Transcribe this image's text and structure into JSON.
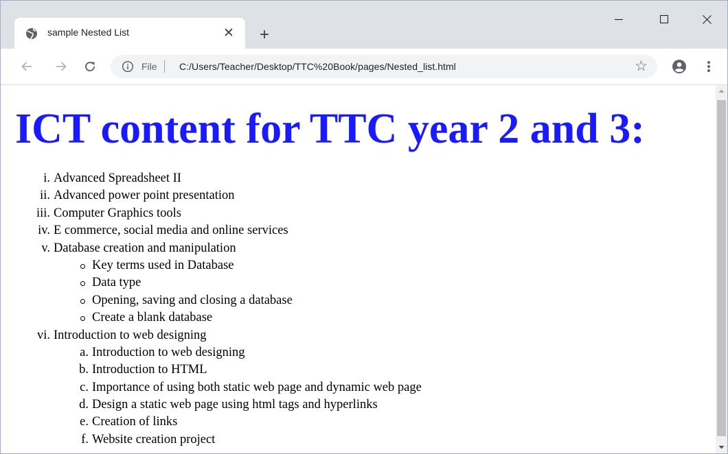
{
  "browser": {
    "tab_title": "sample Nested List",
    "new_tab_label": "+",
    "address_scheme_label": "File",
    "url": "C:/Users/Teacher/Desktop/TTC%20Book/pages/Nested_list.html"
  },
  "page": {
    "heading": "ICT content for TTC year 2 and 3:",
    "heading_color": "#1a1aff",
    "topics": [
      {
        "marker": "i.",
        "text": "Advanced Spreadsheet II"
      },
      {
        "marker": "ii.",
        "text": "Advanced power point presentation"
      },
      {
        "marker": "iii.",
        "text": "Computer Graphics tools"
      },
      {
        "marker": "iv.",
        "text": "E commerce, social media and online services"
      },
      {
        "marker": "v.",
        "text": "Database creation and manipulation",
        "subitems": [
          {
            "marker": "circle",
            "text": "Key terms used in Database"
          },
          {
            "marker": "circle",
            "text": "Data type"
          },
          {
            "marker": "circle",
            "text": "Opening, saving and closing a database"
          },
          {
            "marker": "circle",
            "text": "Create a blank database"
          }
        ]
      },
      {
        "marker": "vi.",
        "text": "Introduction to web designing",
        "subitems": [
          {
            "marker": "a.",
            "text": "Introduction to web designing"
          },
          {
            "marker": "b.",
            "text": "Introduction to HTML"
          },
          {
            "marker": "c.",
            "text": "Importance of using both static web page and dynamic web page"
          },
          {
            "marker": "d.",
            "text": "Design a static web page using html tags and hyperlinks"
          },
          {
            "marker": "e.",
            "text": "Creation of links"
          },
          {
            "marker": "f.",
            "text": "Website creation project"
          }
        ]
      }
    ]
  },
  "icons": {
    "tab_favicon": "globe-icon",
    "tab_close": "close-icon",
    "minimize": "minimize-icon",
    "maximize": "maximize-icon",
    "close_window": "close-window-icon",
    "back": "back-arrow-icon",
    "forward": "forward-arrow-icon",
    "reload": "reload-icon",
    "info": "info-icon",
    "bookmark": "star-icon",
    "profile": "account-icon",
    "menu": "more-vert-icon"
  }
}
